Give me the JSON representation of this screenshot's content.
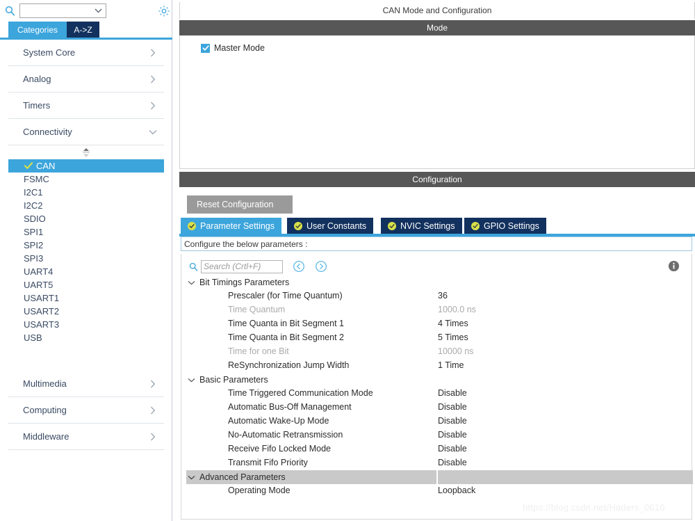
{
  "left_panel": {
    "search": {
      "value": "",
      "icon": "search-icon"
    },
    "settings_icon": "gear-icon",
    "tabs": [
      {
        "label": "Categories",
        "active": true
      },
      {
        "label": "A->Z",
        "active": false
      }
    ],
    "categories": [
      {
        "label": "System Core",
        "expanded": false
      },
      {
        "label": "Analog",
        "expanded": false
      },
      {
        "label": "Timers",
        "expanded": false
      },
      {
        "label": "Connectivity",
        "expanded": true
      }
    ],
    "peripherals": [
      {
        "label": "CAN",
        "selected": true,
        "configured": true
      },
      {
        "label": "FSMC",
        "selected": false,
        "configured": false
      },
      {
        "label": "I2C1",
        "selected": false,
        "configured": false
      },
      {
        "label": "I2C2",
        "selected": false,
        "configured": false
      },
      {
        "label": "SDIO",
        "selected": false,
        "configured": false
      },
      {
        "label": "SPI1",
        "selected": false,
        "configured": false
      },
      {
        "label": "SPI2",
        "selected": false,
        "configured": false
      },
      {
        "label": "SPI3",
        "selected": false,
        "configured": false
      },
      {
        "label": "UART4",
        "selected": false,
        "configured": false
      },
      {
        "label": "UART5",
        "selected": false,
        "configured": false
      },
      {
        "label": "USART1",
        "selected": false,
        "configured": false
      },
      {
        "label": "USART2",
        "selected": false,
        "configured": false
      },
      {
        "label": "USART3",
        "selected": false,
        "configured": false
      },
      {
        "label": "USB",
        "selected": false,
        "configured": false
      }
    ],
    "categories_bottom": [
      {
        "label": "Multimedia",
        "expanded": false
      },
      {
        "label": "Computing",
        "expanded": false
      },
      {
        "label": "Middleware",
        "expanded": false
      }
    ]
  },
  "right_panel": {
    "title": "CAN Mode and Configuration",
    "mode_section": {
      "band_label": "Mode",
      "master_mode": {
        "label": "Master Mode",
        "checked": true
      }
    },
    "config_section": {
      "band_label": "Configuration",
      "reset_button": "Reset Configuration",
      "tabs": [
        {
          "label": "Parameter Settings",
          "active": true
        },
        {
          "label": "User Constants",
          "active": false
        },
        {
          "label": "NVIC Settings",
          "active": false
        },
        {
          "label": "GPIO Settings",
          "active": false
        }
      ],
      "instruction": "Configure the below parameters :",
      "search_placeholder": "Search (Crtl+F)",
      "search_value": "",
      "nav_prev_icon": "circle-left-arrow-icon",
      "nav_next_icon": "circle-right-arrow-icon",
      "info_icon": "info-icon",
      "groups": [
        {
          "name": "Bit Timings Parameters",
          "expanded": true,
          "highlighted": false,
          "params": [
            {
              "name": "Prescaler (for Time Quantum)",
              "value": "36",
              "dimmed": false
            },
            {
              "name": "Time Quantum",
              "value": "1000.0 ns",
              "dimmed": true
            },
            {
              "name": "Time Quanta in Bit Segment 1",
              "value": "4 Times",
              "dimmed": false
            },
            {
              "name": "Time Quanta in Bit Segment 2",
              "value": "5 Times",
              "dimmed": false
            },
            {
              "name": "Time for one Bit",
              "value": "10000 ns",
              "dimmed": true
            },
            {
              "name": "ReSynchronization Jump Width",
              "value": "1 Time",
              "dimmed": false
            }
          ]
        },
        {
          "name": "Basic Parameters",
          "expanded": true,
          "highlighted": false,
          "params": [
            {
              "name": "Time Triggered Communication Mode",
              "value": "Disable",
              "dimmed": false
            },
            {
              "name": "Automatic Bus-Off Management",
              "value": "Disable",
              "dimmed": false
            },
            {
              "name": "Automatic Wake-Up Mode",
              "value": "Disable",
              "dimmed": false
            },
            {
              "name": "No-Automatic Retransmission",
              "value": "Disable",
              "dimmed": false
            },
            {
              "name": "Receive Fifo Locked Mode",
              "value": "Disable",
              "dimmed": false
            },
            {
              "name": "Transmit Fifo Priority",
              "value": "Disable",
              "dimmed": false
            }
          ]
        },
        {
          "name": "Advanced Parameters",
          "expanded": true,
          "highlighted": true,
          "params": [
            {
              "name": "Operating Mode",
              "value": "Loopback",
              "dimmed": false
            }
          ]
        }
      ]
    }
  },
  "watermark": "https://blog.csdn.net/Haders_0610",
  "colors": {
    "accent_blue": "#3ca5dc",
    "dark_navy": "#12315e",
    "band_gray": "#575757",
    "badge_yellow": "#d7e04a",
    "highlight_gray": "#c9c9c9"
  }
}
